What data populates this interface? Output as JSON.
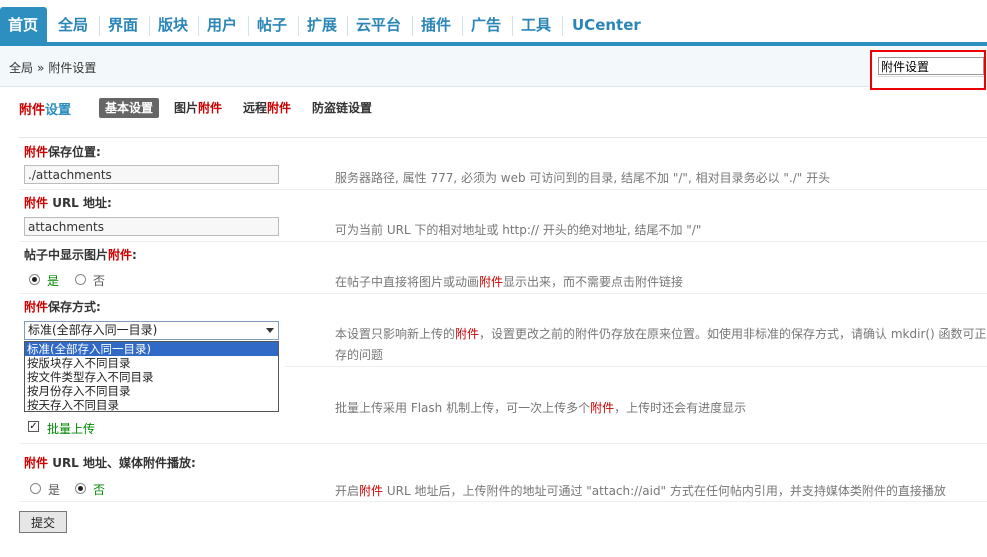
{
  "nav": {
    "items": [
      {
        "label": "首页",
        "active": true
      },
      {
        "label": "全局"
      },
      {
        "label": "界面"
      },
      {
        "label": "版块"
      },
      {
        "label": "用户"
      },
      {
        "label": "帖子"
      },
      {
        "label": "扩展"
      },
      {
        "label": "云平台"
      },
      {
        "label": "插件"
      },
      {
        "label": "广告"
      },
      {
        "label": "工具"
      },
      {
        "label": "UCenter"
      }
    ]
  },
  "breadcrumb": {
    "root": "全局",
    "separator": "»",
    "current": "附件设置"
  },
  "quicksearch": {
    "value": "附件设置"
  },
  "page_title": {
    "part1": "附件",
    "part2": "设置"
  },
  "subtabs": [
    {
      "label": "基本设置",
      "active": true
    },
    {
      "pre": "图片",
      "red": "附件"
    },
    {
      "pre": "远程",
      "red": "附件"
    },
    {
      "label": "防盗链设置"
    }
  ],
  "settings": {
    "save_path": {
      "label_red": "附件",
      "label": "保存位置:",
      "value": "./attachments",
      "tip": "服务器路径, 属性 777, 必须为 web 可访问到的目录, 结尾不加 \"/\", 相对目录务必以 \"./\" 开头"
    },
    "url": {
      "label_red": "附件",
      "label": " URL 地址:",
      "value": "attachments",
      "tip": "可为当前 URL 下的相对地址或 http:// 开头的绝对地址, 结尾不加 \"/\""
    },
    "show_image": {
      "label": "帖子中显示图片",
      "label_red": "附件",
      "label_end": ":",
      "yes": "是",
      "no": "否",
      "tip_pre": "在帖子中直接将图片或动画",
      "tip_red": "附件",
      "tip_post": "显示出来，而不需要点击附件链接"
    },
    "save_mode": {
      "label_red": "附件",
      "label": "保存方式:",
      "selected": "标准(全部存入同一目录)",
      "options": [
        "标准(全部存入同一目录)",
        "按版块存入不同目录",
        "按文件类型存入不同目录",
        "按月份存入不同目录",
        "按天存入不同目录"
      ],
      "tip_pre": "本设置只影响新上传的",
      "tip_red": "附件",
      "tip_post": "，设置更改之前的附件仍存放在原来位置。如使用非标准的保存方式，请确认 mkdir() 函数可正",
      "tip_line2": "存的问题"
    },
    "batch_upload": {
      "label": "批量上传",
      "checked": true,
      "tip_pre": "批量上传采用 Flash 机制上传，可一次上传多个",
      "tip_red": "附件",
      "tip_post": "，上传时还会有进度显示"
    },
    "media": {
      "label_red": "附件",
      "label": " URL 地址、媒体附件播放:",
      "yes": "是",
      "no": "否",
      "tip_pre": "开启",
      "tip_red": "附件",
      "tip_post": " URL 地址后，上传附件的地址可通过 \"attach://aid\" 方式在任何帖内引用，并支持媒体类附件的直接播放"
    }
  },
  "submit_label": "提交",
  "colors": {
    "accent": "#2c8fbf",
    "red": "#cc0000",
    "green": "#008800",
    "highlight": "#3169c6"
  }
}
